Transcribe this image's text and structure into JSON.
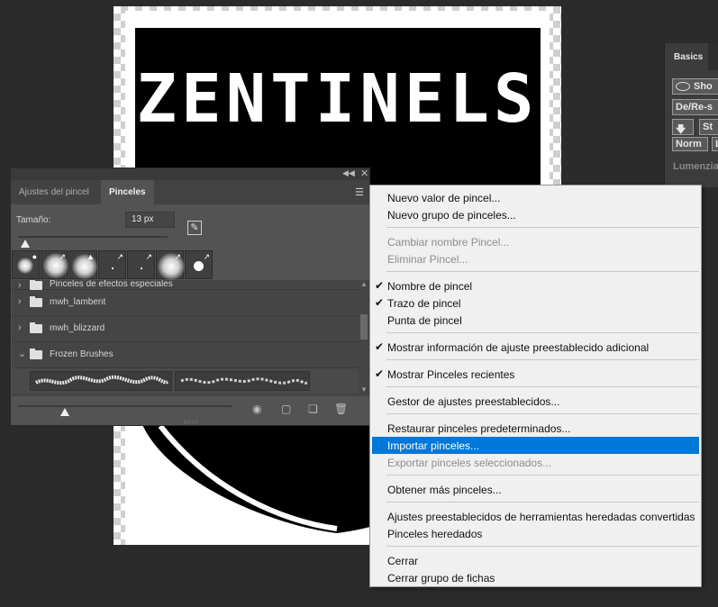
{
  "canvas": {
    "title_text": "ZENTINELS"
  },
  "basics_panel": {
    "tab_label": "Basics",
    "buttons": [
      "Sho",
      "De/Re-s",
      "St",
      "Norm",
      "L"
    ],
    "luminance_label": "Lumenzia"
  },
  "brushes_panel": {
    "tabs": [
      {
        "label": "Ajustes del pincel",
        "active": false
      },
      {
        "label": "Pinceles",
        "active": true
      }
    ],
    "size_label": "Tamaño:",
    "size_value": "13 px",
    "groups": [
      {
        "label": "Pinceles de efectos especiales"
      },
      {
        "label": "mwh_lambent"
      },
      {
        "label": "mwh_blizzard"
      },
      {
        "label": "Frozen Brushes",
        "expanded": true
      }
    ]
  },
  "menu": {
    "items": [
      {
        "label": "Nuevo valor de pincel...",
        "enabled": true,
        "checked": false
      },
      {
        "label": "Nuevo grupo de pinceles...",
        "enabled": true,
        "checked": false
      },
      {
        "label": "Cambiar nombre Pincel...",
        "enabled": false,
        "checked": false
      },
      {
        "label": "Eliminar Pincel...",
        "enabled": false,
        "checked": false
      },
      {
        "label": "Nombre de pincel",
        "enabled": true,
        "checked": true
      },
      {
        "label": "Trazo de pincel",
        "enabled": true,
        "checked": true
      },
      {
        "label": "Punta de pincel",
        "enabled": true,
        "checked": false
      },
      {
        "label": "Mostrar información de ajuste preestablecido adicional",
        "enabled": true,
        "checked": true
      },
      {
        "label": "Mostrar Pinceles recientes",
        "enabled": true,
        "checked": true
      },
      {
        "label": "Gestor de ajustes preestablecidos...",
        "enabled": true,
        "checked": false
      },
      {
        "label": "Restaurar pinceles predeterminados...",
        "enabled": true,
        "checked": false
      },
      {
        "label": "Importar pinceles...",
        "enabled": true,
        "checked": false,
        "highlighted": true
      },
      {
        "label": "Exportar pinceles seleccionados...",
        "enabled": false,
        "checked": false
      },
      {
        "label": "Obtener más pinceles...",
        "enabled": true,
        "checked": false
      },
      {
        "label": "Ajustes preestablecidos de herramientas heredadas convertidas",
        "enabled": true,
        "checked": false
      },
      {
        "label": "Pinceles heredados",
        "enabled": true,
        "checked": false
      },
      {
        "label": "Cerrar",
        "enabled": true,
        "checked": false
      },
      {
        "label": "Cerrar grupo de fichas",
        "enabled": true,
        "checked": false
      }
    ],
    "highlight_color": "#0078d7"
  },
  "icons": {
    "panel_collapse": "double-chevron-icon",
    "panel_close": "close-icon",
    "panel_menu": "hamburger-menu-icon",
    "flip": "brush-flip-icon",
    "footer": [
      "eye-visibility-icon",
      "new-folder-icon",
      "new-brush-icon",
      "trash-icon"
    ],
    "group": "folder-icon",
    "check": "checkmark-icon"
  }
}
